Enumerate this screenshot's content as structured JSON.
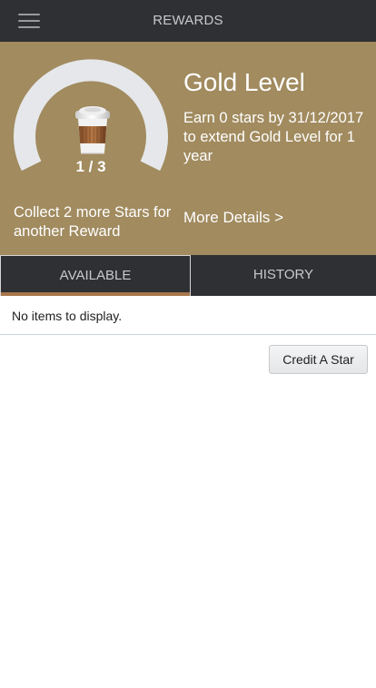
{
  "header": {
    "title": "REWARDS",
    "menu_icon": "hamburger-menu-icon"
  },
  "rewards": {
    "progress_label": "1 / 3",
    "stars_collected": 1,
    "stars_needed": 3,
    "cup_icon": "coffee-cup-icon",
    "collect_message": "Collect 2 more Stars for another Reward",
    "level_title": "Gold Level",
    "level_description": "Earn 0 stars by 31/12/2017 to extend Gold Level for 1 year",
    "more_details_label": "More Details >"
  },
  "tabs": [
    {
      "label": "AVAILABLE",
      "active": true
    },
    {
      "label": "HISTORY",
      "active": false
    }
  ],
  "list": {
    "empty_message": "No items to display."
  },
  "actions": {
    "credit_star_label": "Credit A Star"
  },
  "colors": {
    "topbar": "#2f3033",
    "hero": "#a18b5f",
    "gauge_track": "#e5e7ea",
    "tab_indicator": "#a7764b"
  }
}
